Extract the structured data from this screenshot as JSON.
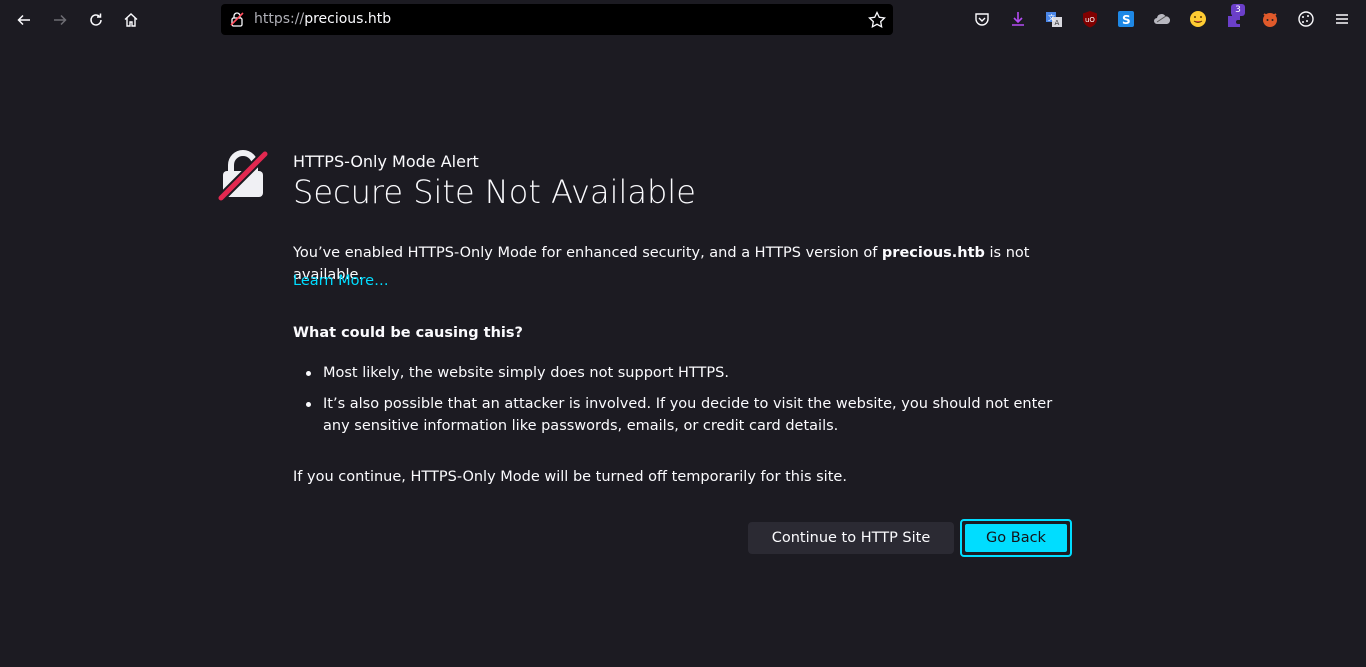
{
  "browser": {
    "url_scheme": "https://",
    "url_host": "precious.htb",
    "extensions_badge": "3",
    "accent_color": "#00ddff"
  },
  "icons": [
    "back-arrow-icon",
    "forward-arrow-icon",
    "reload-icon",
    "home-icon",
    "insecure-lock-icon",
    "bookmark-star-icon",
    "pocket-icon",
    "download-icon",
    "translate-icon",
    "ublock-icon",
    "s-extension-icon",
    "cloud-icon",
    "emoji-icon",
    "extension-puzzle-icon",
    "fox-extension-icon",
    "cookie-icon",
    "hamburger-menu-icon"
  ],
  "alert": {
    "subtitle": "HTTPS-Only Mode Alert",
    "title": "Secure Site Not Available",
    "intro_prefix": "You’ve enabled HTTPS-Only Mode for enhanced security, and a HTTPS version of ",
    "intro_site": "precious.htb",
    "intro_suffix": " is not available.",
    "learn_more": "Learn More…",
    "cause_heading": "What could be causing this?",
    "causes": [
      "Most likely, the website simply does not support HTTPS.",
      "It’s also possible that an attacker is involved. If you decide to visit the website, you should not enter any sensitive information like passwords, emails, or credit card details."
    ],
    "footer_note": "If you continue, HTTPS-Only Mode will be turned off temporarily for this site.",
    "continue_button": "Continue to HTTP Site",
    "back_button": "Go Back"
  }
}
